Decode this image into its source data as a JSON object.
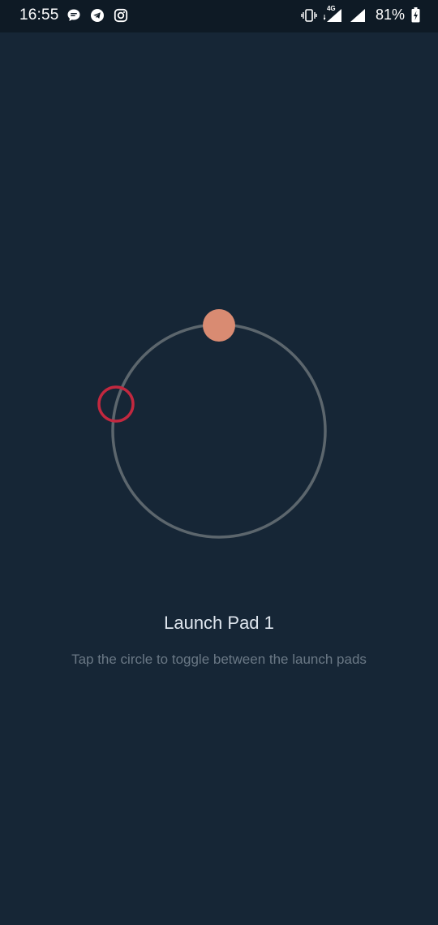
{
  "status_bar": {
    "time": "16:55",
    "notification_icons": [
      "chat-bubble-icon",
      "telegram-icon",
      "instagram-icon"
    ],
    "system_icons": [
      "vibrate-icon",
      "signal-4g-icon",
      "signal-icon",
      "battery-charging-icon"
    ],
    "network_label": "4G",
    "battery": "81%"
  },
  "launch_pad": {
    "title": "Launch Pad 1",
    "hint": "Tap the circle to toggle between the launch pads"
  },
  "colors": {
    "background": "#162636",
    "status_bar": "#0e1a25",
    "orbit": "#5c666d",
    "active_pad": "#d98b72",
    "inactive_pad": "#c2283f"
  }
}
